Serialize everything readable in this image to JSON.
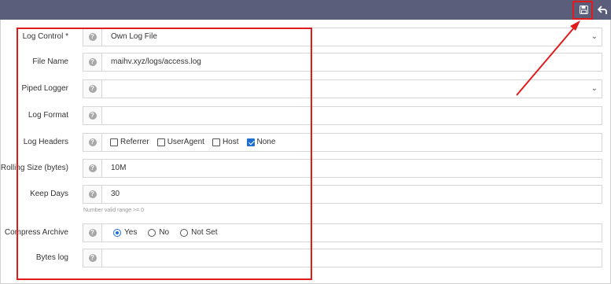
{
  "toolbar": {
    "save_icon": "floppy-disk-icon",
    "undo_icon": "undo-arrow-icon",
    "bar_color": "#5b5e7a"
  },
  "help_glyph": "?",
  "form": {
    "log_control": {
      "label": "Log Control *",
      "value": "Own Log File"
    },
    "file_name": {
      "label": "File Name",
      "value": "maihv.xyz/logs/access.log"
    },
    "piped_logger": {
      "label": "Piped Logger",
      "value": ""
    },
    "log_format": {
      "label": "Log Format",
      "value": ""
    },
    "log_headers": {
      "label": "Log Headers",
      "options": [
        {
          "label": "Referrer",
          "checked": false
        },
        {
          "label": "UserAgent",
          "checked": false
        },
        {
          "label": "Host",
          "checked": false
        },
        {
          "label": "None",
          "checked": true
        }
      ]
    },
    "rolling_size": {
      "label": "Rolling Size (bytes)",
      "value": "10M"
    },
    "keep_days": {
      "label": "Keep Days",
      "value": "30",
      "hint": "Number valid range >= 0"
    },
    "compress_archive": {
      "label": "Compress Archive",
      "options": [
        {
          "label": "Yes",
          "selected": true
        },
        {
          "label": "No",
          "selected": false
        },
        {
          "label": "Not Set",
          "selected": false
        }
      ]
    },
    "bytes_log": {
      "label": "Bytes log",
      "value": ""
    }
  },
  "annotation_color": "#e01b1b",
  "checkbox_accent": "#1f6fd1"
}
